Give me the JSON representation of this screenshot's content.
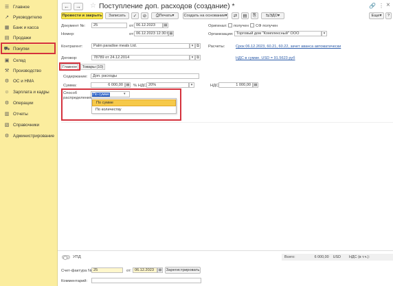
{
  "sidebar": {
    "items": [
      {
        "label": "Главное",
        "icon": "home-icon"
      },
      {
        "label": "Руководителю",
        "icon": "chart-icon"
      },
      {
        "label": "Банк и касса",
        "icon": "bank-icon"
      },
      {
        "label": "Продажи",
        "icon": "sales-icon"
      },
      {
        "label": "Покупки",
        "icon": "cart-icon"
      },
      {
        "label": "Склад",
        "icon": "warehouse-icon"
      },
      {
        "label": "Производство",
        "icon": "factory-icon"
      },
      {
        "label": "ОС и НМА",
        "icon": "assets-icon"
      },
      {
        "label": "Зарплата и кадры",
        "icon": "salary-icon"
      },
      {
        "label": "Операции",
        "icon": "operations-icon"
      },
      {
        "label": "Отчеты",
        "icon": "reports-icon"
      },
      {
        "label": "Справочники",
        "icon": "directory-icon"
      },
      {
        "label": "Администрирование",
        "icon": "admin-icon"
      }
    ],
    "active_item": "Покупки"
  },
  "header": {
    "back_icon": "←",
    "forward_icon": "→",
    "title": "Поступление доп. расходов (создание) *",
    "link_icon": "🔗",
    "more_icon": "⋮",
    "close_icon": "×"
  },
  "toolbar": {
    "post_close": "Провести и закрыть",
    "save": "Записать",
    "print": "Печать",
    "create_based": "Создать на основании",
    "edo": "ЭДО",
    "more": "Еще",
    "help": "?"
  },
  "form": {
    "doc_no_label": "Документ №:",
    "doc_no": "25",
    "date_from_label": "от:",
    "date": "06.12.2023",
    "number_label": "Номер:",
    "datetime": "06.12.2023 12:30:00",
    "original_label": "Оригинал:",
    "received_label": "получен",
    "sf_received_label": "СФ получен",
    "org_label": "Организация:",
    "org": "Торговый дом \"Комплексный\" ООО",
    "counterparty_label": "Контрагент:",
    "counterparty": "Palm paradise meals Ltd.",
    "settlements_label": "Расчеты:",
    "settlements_link": "Срок 06.12.2023, 60.21, 60.22, зачет аванса автоматически",
    "contract_label": "Договор:",
    "contract": "78789 от 24.12.2014",
    "vat_link": "НДС в сумме. USD = 91.5623 руб"
  },
  "tabs": {
    "main": "Главное",
    "goods": "Товары (10)"
  },
  "main_tab": {
    "content_label": "Содержание:",
    "content": "Доп. расходы",
    "sum_label": "Сумма:",
    "sum": "6 000,00",
    "vat_pct_label": "% НДС:",
    "vat_pct": "20%",
    "vat_label": "НДС:",
    "vat": "1 000,00",
    "dist_label_1": "Способ",
    "dist_label_2": "распределения:",
    "dist_selected": "По сумме",
    "dist_options": [
      "По сумме",
      "По количеству"
    ]
  },
  "footer": {
    "upd_label": "УПД",
    "total_label": "Всего:",
    "total_value": "6 000,00",
    "total_currency": "USD",
    "vat_in_label": "НДС (в т.ч.):",
    "invoice_label": "Счет-фактура №:",
    "invoice_no": "25",
    "invoice_date_label": "от:",
    "invoice_date": "06.12.2023",
    "register_button": "Зарегистрировать",
    "comment_label": "Комментарий:"
  }
}
